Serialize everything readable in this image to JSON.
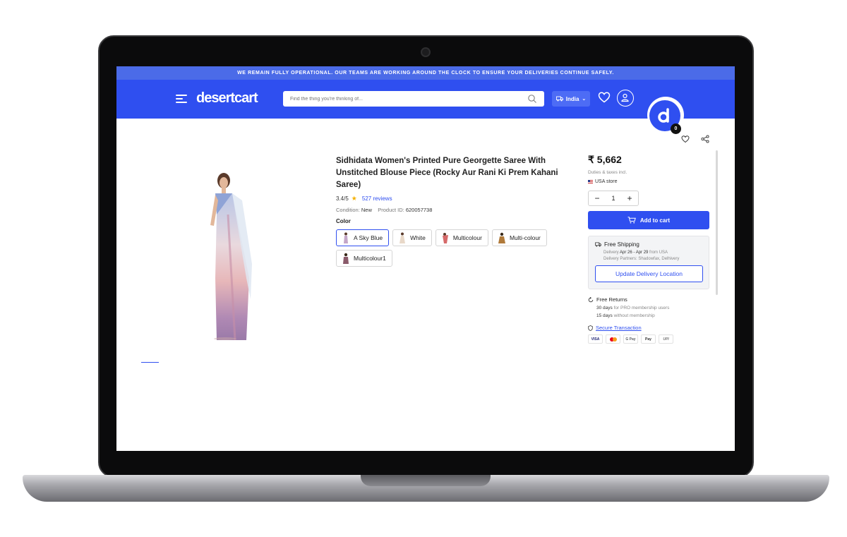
{
  "banner": {
    "text": "WE REMAIN FULLY OPERATIONAL. OUR TEAMS ARE WORKING AROUND THE CLOCK TO ENSURE YOUR DELIVERIES CONTINUE SAFELY."
  },
  "header": {
    "logo": "desertcart",
    "search_placeholder": "Find the thing you're thinking of...",
    "country": "India",
    "cart_count": "0",
    "brand_color": "#2f4ff0"
  },
  "product": {
    "title": "Sidhidata Women's Printed Pure Georgette Saree With Unstitched Blouse Piece (Rocky Aur Rani Ki Prem Kahani Saree)",
    "rating": "3.4/5",
    "reviews": "527 reviews",
    "condition_label": "Condition:",
    "condition_value": "New",
    "product_id_label": "Product ID:",
    "product_id_value": "620057738",
    "color_label": "Color",
    "colors": [
      {
        "label": "A Sky Blue",
        "selected": true
      },
      {
        "label": "White",
        "selected": false
      },
      {
        "label": "Multicolour",
        "selected": false
      },
      {
        "label": "Multi-colour",
        "selected": false
      },
      {
        "label": "Multicolour1",
        "selected": false
      }
    ]
  },
  "purchase": {
    "price": "₹ 5,662",
    "duties": "Duties & taxes incl.",
    "store": "USA store",
    "quantity": "1",
    "add_to_cart": "Add to cart",
    "shipping_title": "Free Shipping",
    "delivery_label": "Delivery",
    "delivery_dates": "Apr 26 - Apr 29",
    "delivery_from": "from USA",
    "partners": "Delivery Partners: Shadowfax, Delhivery",
    "update_location": "Update Delivery Location",
    "returns_title": "Free Returns",
    "returns_pro_days": "30 days",
    "returns_pro_text": "for PRO membership users",
    "returns_std_days": "15 days",
    "returns_std_text": "without membership",
    "secure": "Secure Transaction",
    "payments": [
      "VISA",
      "MC",
      "G Pay",
      "Pay",
      "UPI"
    ]
  }
}
